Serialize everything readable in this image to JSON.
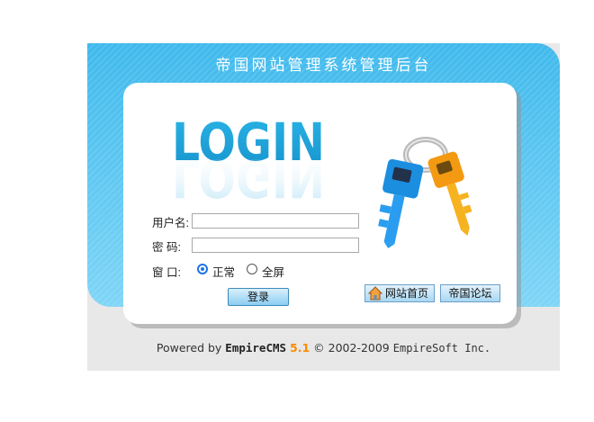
{
  "header": {
    "title": "帝国网站管理系统管理后台"
  },
  "logo": {
    "text": "LOGIN",
    "color": "#1fa7dd"
  },
  "form": {
    "username_label": "用户名:",
    "username_value": "",
    "password_label": "密 码:",
    "password_value": "",
    "window_label": "窗 口:",
    "window_options": [
      {
        "label": "正常",
        "selected": true
      },
      {
        "label": "全屏",
        "selected": false
      }
    ],
    "login_button": "登录"
  },
  "links": {
    "home": "网站首页",
    "forum": "帝国论坛"
  },
  "icons": {
    "keys": "keys-icon",
    "home": "home-icon"
  },
  "footer": {
    "powered": "Powered by",
    "brand": "EmpireCMS",
    "version": "5.1",
    "copyright": "© 2002-2009",
    "company": "EmpireSoft Inc."
  },
  "colors": {
    "banner": "#4cbff0",
    "accent_version": "#ff8a00"
  }
}
